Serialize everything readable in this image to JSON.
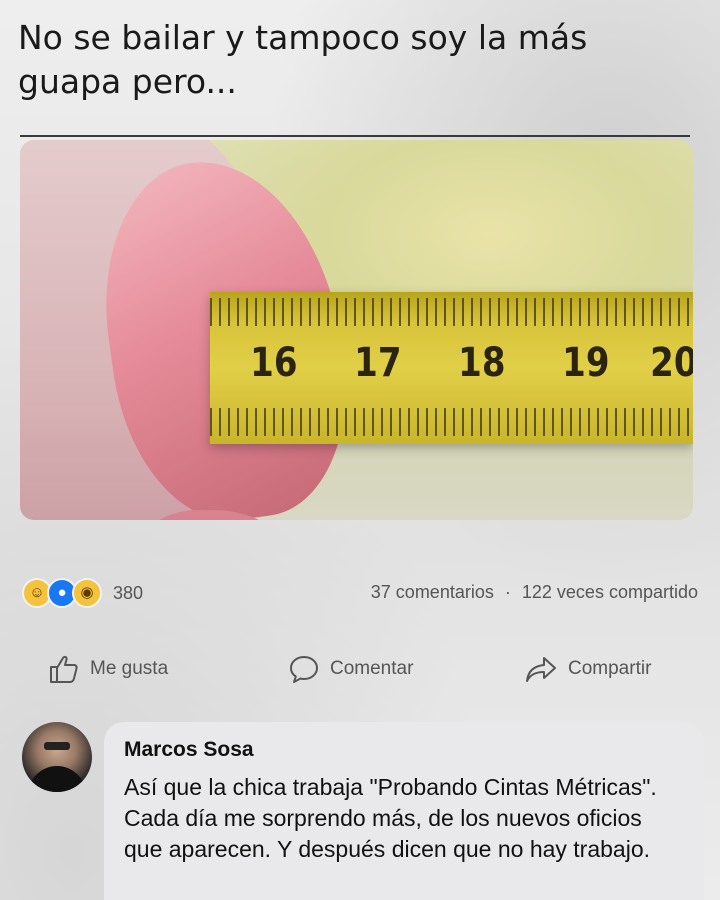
{
  "post": {
    "text": "No se bailar y tampoco soy la más guapa pero..."
  },
  "photo": {
    "tape_numbers": [
      "16",
      "17",
      "18",
      "19",
      "20"
    ]
  },
  "reactions": {
    "icons": [
      "haha-icon",
      "like-icon",
      "wow-icon"
    ],
    "count": "380"
  },
  "stats": {
    "comments": "37 comentarios",
    "separator": "·",
    "shares": "122 veces compartido"
  },
  "actions": {
    "like": "Me gusta",
    "comment": "Comentar",
    "share": "Compartir"
  },
  "comment": {
    "author": "Marcos Sosa",
    "text": "Así que la chica trabaja \"Probando Cintas Métricas\". Cada día me sorprendo más, de los nuevos oficios que aparecen. Y después dicen que no hay trabajo."
  },
  "colors": {
    "like_blue": "#1877f2",
    "reaction_yellow": "#f5c33b",
    "tape_yellow": "#e1cf48"
  }
}
